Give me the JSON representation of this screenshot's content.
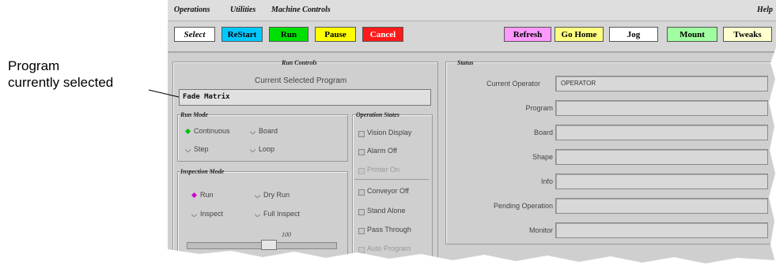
{
  "callout": {
    "line1": "Program",
    "line2": "currently selected"
  },
  "menu": {
    "items": [
      "Operations",
      "Utilities",
      "Machine Controls"
    ],
    "help": "Help"
  },
  "toolbar": {
    "select": "Select",
    "restart": "ReStart",
    "run": "Run",
    "pause": "Pause",
    "cancel": "Cancel",
    "refresh": "Refresh",
    "go_home": "Go Home",
    "jog": "Jog",
    "mount": "Mount",
    "tweaks": "Tweaks"
  },
  "colors": {
    "restart": "#00c8ff",
    "run": "#00e000",
    "pause": "#ffff00",
    "cancel": "#ff1a1a",
    "refresh": "#ff99ff",
    "go_home": "#ffff80",
    "jog": "#ffffff",
    "mount": "#a0ffa0",
    "tweaks": "#ffffd0",
    "radio_continuous": "#00c000",
    "radio_run": "#cc00cc"
  },
  "run_controls": {
    "title": "Run Controls",
    "current_program_label": "Current Selected Program",
    "current_program_value": "Fade Matrix",
    "run_mode": {
      "title": "Run Mode",
      "continuous": "Continuous",
      "board": "Board",
      "step": "Step",
      "loop": "Loop",
      "selected": "Continuous"
    },
    "inspection_mode": {
      "title": "Inspection Mode",
      "run": "Run",
      "dry_run": "Dry Run",
      "inspect": "Inspect",
      "full_inspect": "Full Inspect",
      "selected": "Run"
    },
    "slider": {
      "value": "100"
    }
  },
  "operation_states": {
    "title": "Operation States",
    "vision_display": "Vision Display",
    "alarm_off": "Alarm Off",
    "printer_on": "Printer On",
    "conveyor_off": "Conveyor Off",
    "stand_alone": "Stand Alone",
    "pass_through": "Pass Through",
    "auto_program": "Auto Program"
  },
  "status": {
    "title": "Status",
    "current_operator_label": "Current Operator",
    "current_operator_value": "OPERATOR",
    "program_label": "Program",
    "board_label": "Board",
    "shape_label": "Shape",
    "info_label": "Info",
    "pending_operation_label": "Pending Operation",
    "monitor_label": "Monitor"
  }
}
